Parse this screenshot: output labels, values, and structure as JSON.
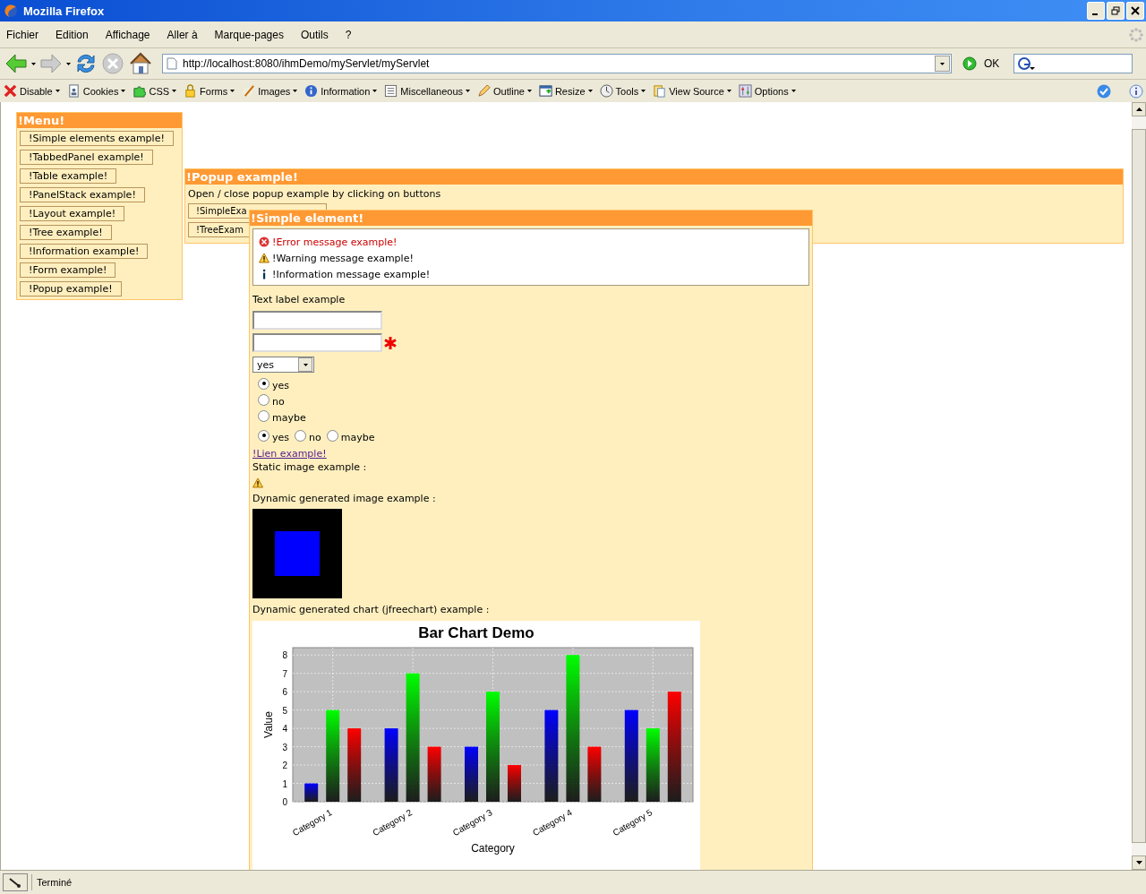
{
  "window": {
    "title": "Mozilla Firefox"
  },
  "menu_bar": [
    "Fichier",
    "Edition",
    "Affichage",
    "Aller à",
    "Marque-pages",
    "Outils",
    "?"
  ],
  "address_bar": {
    "url": "http://localhost:8080/ihmDemo/myServlet/myServlet",
    "go_label": "OK"
  },
  "dev_toolbar": [
    "Disable",
    "Cookies",
    "CSS",
    "Forms",
    "Images",
    "Information",
    "Miscellaneous",
    "Outline",
    "Resize",
    "Tools",
    "View Source",
    "Options"
  ],
  "menu_panel": {
    "title": "!Menu!",
    "buttons": [
      "!Simple elements example!",
      "!TabbedPanel example!",
      "!Table example!",
      "!PanelStack example!",
      "!Layout example!",
      "!Tree example!",
      "!Information example!",
      "!Form example!",
      "!Popup example!"
    ]
  },
  "popup_panel": {
    "title": "!Popup example!",
    "text": "Open / close popup example by clicking on buttons",
    "buttons": [
      "!SimpleExa",
      "!TreeExam"
    ]
  },
  "simple_panel": {
    "title": "!Simple element!",
    "messages": [
      {
        "kind": "error",
        "text": "!Error message example!"
      },
      {
        "kind": "warning",
        "text": "!Warning message example!"
      },
      {
        "kind": "info",
        "text": "!Information message example!"
      }
    ],
    "text_label": "Text label example",
    "fields": [
      {
        "required": false
      },
      {
        "required": true
      }
    ],
    "select": {
      "value": "yes"
    },
    "radio_vertical": [
      {
        "label": "yes",
        "selected": true
      },
      {
        "label": "no",
        "selected": false
      },
      {
        "label": "maybe",
        "selected": false
      }
    ],
    "radio_inline": [
      {
        "label": "yes",
        "selected": true
      },
      {
        "label": "no",
        "selected": false
      },
      {
        "label": "maybe",
        "selected": false
      }
    ],
    "link": "!Lien example!",
    "static_image_label": "Static image example :",
    "dynamic_image_label": "Dynamic generated image example :",
    "chart_label": "Dynamic generated chart (jfreechart) example :",
    "chart_data": {
      "type": "bar",
      "title": "Bar Chart Demo",
      "xlabel": "Category",
      "ylabel": "Value",
      "categories": [
        "Category 1",
        "Category 2",
        "Category 3",
        "Category 4",
        "Category 5"
      ],
      "series": [
        {
          "color": "#0000ff",
          "values": [
            1,
            4,
            3,
            5,
            5
          ]
        },
        {
          "color": "#00ff00",
          "values": [
            5,
            7,
            6,
            8,
            4
          ]
        },
        {
          "color": "#ff0000",
          "values": [
            4,
            3,
            2,
            3,
            6
          ]
        }
      ],
      "ylim": [
        0,
        8.4
      ],
      "grid": true,
      "yticks": [
        0,
        1,
        2,
        3,
        4,
        5,
        6,
        7,
        8
      ]
    }
  },
  "status_bar": {
    "text": "Terminé"
  }
}
